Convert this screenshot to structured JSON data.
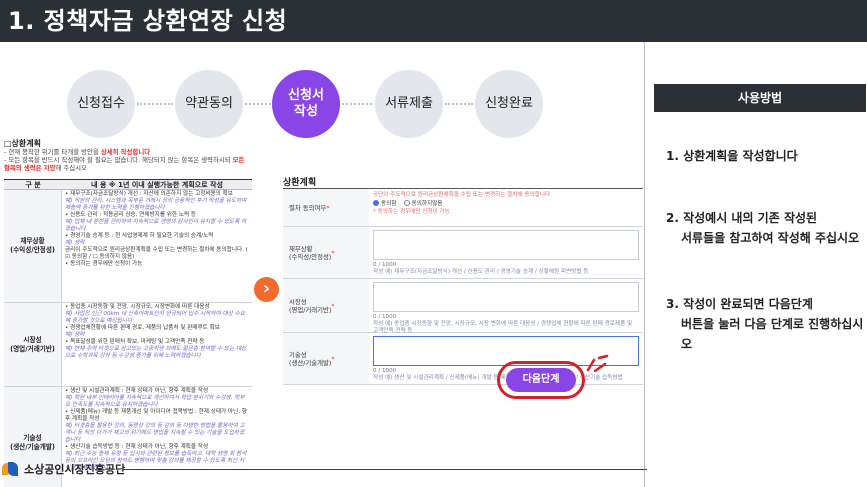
{
  "page": {
    "title": "1. 정책자금 상환연장 신청"
  },
  "steps": [
    {
      "label": "신청접수",
      "active": false
    },
    {
      "label": "약관동의",
      "active": false
    },
    {
      "label": "신청서\n작성",
      "active": true
    },
    {
      "label": "서류제출",
      "active": false
    },
    {
      "label": "신청완료",
      "active": false
    }
  ],
  "doc": {
    "heading": "□상환계획",
    "notes": [
      "- 현재 봉착한 위기를 타개할 방안을 ",
      "상세히 작성합니다",
      "- 모든 항목을 반드시 작성해야 할 필요는 없습니다. 해당되지 않는 항목은 생략하시되 ",
      "모든 항목의 생략은 지양",
      "해 주십시오"
    ],
    "table_header": {
      "col1": "구 분",
      "col2": "내 용 ※ 1년 이내 실행가능한 계획으로 작성"
    },
    "rows": [
      {
        "label": "재무상황\n(수익성/안정성)",
        "lines": [
          "• 재무구조(자금조달방식) 개선 : 자산에 의존하지 않는 고정비용의 확보",
          "예) 직원의 관리, 시스템과 목부운 거래시 상의 금융적인 후기 작성을 유도하여 재출액 증가를 위한 노력을 진행하겠습니다",
          "• 신용도 관리 : 적용금리 상승, 연체방지를 위한 노력 등",
          "예) 업체 내 분한을 관리하여 지속적으로 경영의 감사인이 유지할 수 있도록 하겠습니다",
          "• 경영기술 승계 등 : 현 사업영제계 하 필요한 기술의 승계/노력",
          "예) 생략",
          "금리이 주도적으로 원리금상환계획을 수립 또는 변경하는 절차에 동의합니다. ( ☑ 동의함 / ☐ 동의하지 않음)",
          "• 동의하는 경우에만 신청이 가능"
        ]
      },
      {
        "label": "시장성\n(영업/거래기반)",
        "lines": [
          "• 동업종 시장동향 및 전망, 시장규모, 시장변화에 따른 대응성",
          "예) 사업장 인근 00km 내 신축아파트단지 완공되어 입주 시작하여 대상 수요에 증가할 것으로 예상됩니다",
          "• 경쟁업체현황에 따른 판매 경로, 제품의 납품처 및 판매루트 확보",
          "예) 생략",
          "• 목표달성을 위한 판매처 확보, 마케팅 및 고객만족 전략 등",
          "예) 현재 주력 타겟으로 삼고있는 고중학생 외에도 젊은층 참여할 수 있는 대상으로 수학과목 강좌 등 수강생 증가를 위해 노력하겠습니다"
        ]
      },
      {
        "label": "기술성\n(생산/기술개발)",
        "lines": [
          "• 생산 및 시설관리계획 : 현재 상태가 아닌, 향후 계획을 작성",
          "예) 학원 내부 인테리어를 지속적으로 개선하여서 학업 분위기와 수강생, 학부모 만족도를 지속적으로 유지하겠습니다",
          "• 신제품(메뉴) 개발 등 제품개선 및 아이디어 접목방법 : 현재 상태가 아닌, 향후 계획을 작성",
          "예) 타겟층을 활용한 강의, 동영상 강의 등 강의 등 다양한 방법을 활용하여 고객니 등 직장 다가가 재고의 위기에도 영업을 지속할 수 있는 기술을 도입하겠습니다",
          "• 생산기술 습득방법 등 : 현재 상태가 아닌, 향후 계획을 작성",
          "예) 최근 수능 출제 유형 등 입시와 관련된 정보를 습득하고, 대학 생명 회 참석 등의 오프라인 모임의 참석도 병행하여 맞춤 강의를 제공할 수 있도록 최신 지식을 공유하겠습니다"
        ]
      }
    ]
  },
  "form": {
    "title": "상환계획",
    "rows": [
      {
        "label": "절차 동의여부",
        "text1": "공단이 주도적으로 원리금상환계획을 수립 또는 변경하는 절차에 동의합니다.",
        "opt_yes": "동의함",
        "opt_no": "동의하지않음",
        "note": "* 동의하는 경우에만 신청이 가능"
      },
      {
        "label": "재무상황\n(수익성/안정성)",
        "count": "0 / 1000",
        "hint": "작성 예) 재무구조(자금조달방식) 개선 / 신용도 관리 / 경영기술 승계 / 상황해원 피변방법 등"
      },
      {
        "label": "시장성\n(영업/거래기반)",
        "count": "0 / 1000",
        "hint": "작성 예) 동업종 시장동향 및 전망, 시장규모, 시장 변화에 따른 대응성 / 경쟁업체 현황에 따른 판매 경로제품 및 고객만족 전략 등"
      },
      {
        "label": "기술성\n(생산/기술개발)",
        "count": "0 / 1000",
        "hint": "작성 예) 생산 및 시설관리계획 / 신제품(메뉴) 개발 등 제품 개선 및 아이디어 접목방법 / 생산기술 습득방법"
      }
    ],
    "next_button": "다음단계"
  },
  "usage": {
    "header": "사용방법",
    "items": [
      {
        "first": "1. 상환계획을 작성합니다",
        "rest": ""
      },
      {
        "first": "2. 작성예시 내의 기존 작성된",
        "rest": "서류들을 참고하여 작성해 주십시오"
      },
      {
        "first": "3. 작성이 완료되면 다음단계",
        "rest": "버튼을 눌러 다음 단계로 진행하십시오"
      }
    ]
  },
  "footer": {
    "org": "소상공인시장진흥공단"
  },
  "colors": {
    "accent": "#8a45e6",
    "header": "#2b2f36",
    "arrow": "#f26a2e",
    "highlight": "#d81f26"
  }
}
